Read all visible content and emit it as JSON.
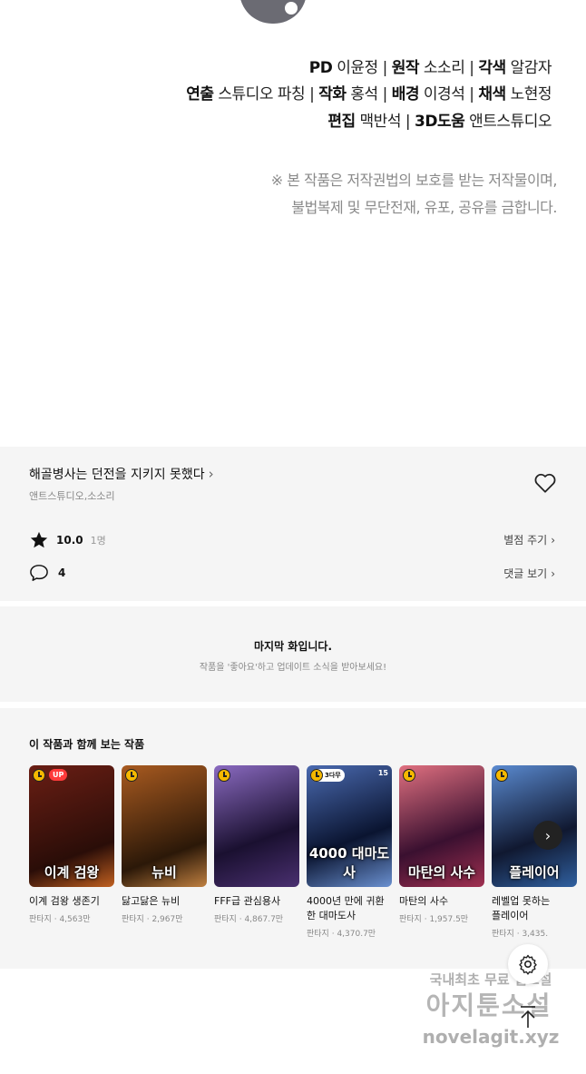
{
  "credits": {
    "line1": [
      {
        "role": "PD",
        "name": "이윤정"
      },
      {
        "role": "원작",
        "name": "소소리"
      },
      {
        "role": "각색",
        "name": "알감자"
      }
    ],
    "line2": [
      {
        "role": "연출",
        "name": "스튜디오 파칭"
      },
      {
        "role": "작화",
        "name": "홍석"
      },
      {
        "role": "배경",
        "name": "이경석"
      },
      {
        "role": "채색",
        "name": "노현정"
      }
    ],
    "line3": [
      {
        "role": "편집",
        "name": "맥반석"
      },
      {
        "role": "3D도움",
        "name": "앤트스튜디오"
      }
    ],
    "separator": " | ",
    "notice1": "※ 본 작품은 저작권법의 보호를 받는 저작물이며,",
    "notice2": "불법복제 및 무단전재, 유포, 공유를 금합니다."
  },
  "work": {
    "title": "해골병사는 던전을 지키지 못했다",
    "authors": "앤트스튜디오,소소리",
    "rating": "10.0",
    "rating_count": "1명",
    "rate_link": "별점 주기",
    "comments": "4",
    "comment_link": "댓글 보기"
  },
  "last_episode": {
    "title": "마지막 화입니다.",
    "subtitle": "작품을 '좋아요'하고 업데이트 소식을 받아보세요!"
  },
  "recommend": {
    "heading": "이 작품과 함께 보는 작품",
    "items": [
      {
        "name": "이계 검왕 생존기",
        "genre": "판타지",
        "views": "4,563만",
        "badge": "UP",
        "cover_text": "이계 검왕",
        "color1": "#6a1e14",
        "color2": "#2a0d08"
      },
      {
        "name": "닳고닳은 뉴비",
        "genre": "판타지",
        "views": "2,967만",
        "badge": "",
        "cover_text": "뉴비",
        "color1": "#8a4a1a",
        "color2": "#2b1808"
      },
      {
        "name": "FFF급 관심용사",
        "genre": "판타지",
        "views": "4,867.7만",
        "badge": "",
        "cover_text": "",
        "color1": "#6a4a9a",
        "color2": "#1a1030"
      },
      {
        "name": "4000년 만에 귀환한 대마도사",
        "genre": "판타지",
        "views": "4,370.7만",
        "badge": "3다무",
        "age": "15",
        "cover_text": "4000 대마도사",
        "color1": "#2a4a8a",
        "color2": "#0a1430"
      },
      {
        "name": "마탄의 사수",
        "genre": "판타지",
        "views": "1,957.5만",
        "badge": "",
        "cover_text": "마탄의 사수",
        "color1": "#c05060",
        "color2": "#3a1030"
      },
      {
        "name": "레벨업 못하는 플레이어",
        "genre": "판타지",
        "views": "3,435.",
        "badge": "",
        "cover_text": "플레이어",
        "color1": "#3a6ab0",
        "color2": "#101830"
      }
    ],
    "meta_sep": " · "
  },
  "colors": {
    "panel_bg": "#f5f5f5",
    "up_badge": "#ff3b3b",
    "clock_badge": "#f5b800"
  },
  "watermark": {
    "line1": "국내최초 무료 웹소설",
    "line2": "아지툰소설",
    "line3": "novelagit.xyz"
  },
  "icons": [
    "heart-icon",
    "star-icon",
    "comment-icon",
    "chevron-right-icon",
    "settings-icon",
    "scroll-top-icon"
  ]
}
